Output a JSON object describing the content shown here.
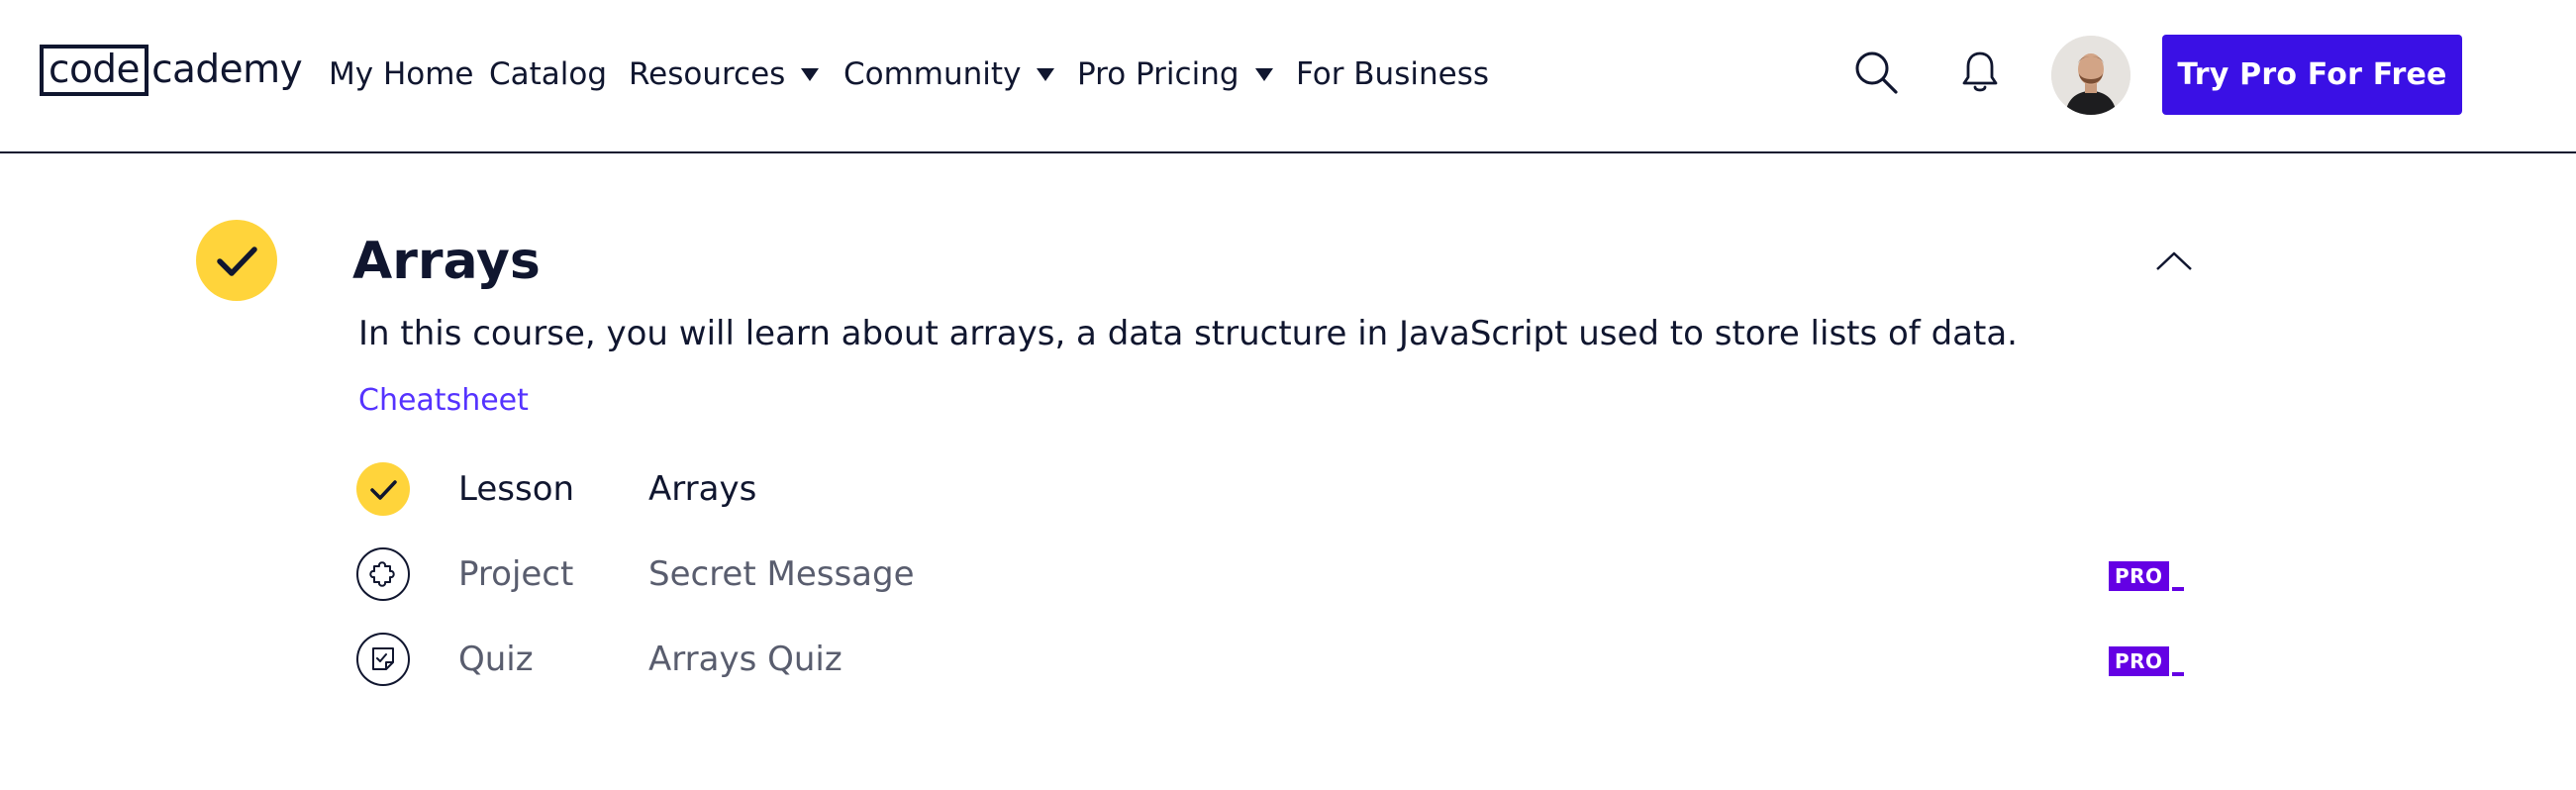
{
  "header": {
    "logo": {
      "boxed": "code",
      "rest": "cademy"
    },
    "nav": [
      {
        "label": "My Home",
        "dropdown": false
      },
      {
        "label": "Catalog",
        "dropdown": false
      },
      {
        "label": "Resources",
        "dropdown": true
      },
      {
        "label": "Community",
        "dropdown": true
      },
      {
        "label": "Pro Pricing",
        "dropdown": true
      },
      {
        "label": "For Business",
        "dropdown": false
      }
    ],
    "icons": [
      "search-icon",
      "bell-icon"
    ],
    "cta_label": "Try Pro For Free"
  },
  "module": {
    "title": "Arrays",
    "completed": true,
    "description": "In this course, you will learn about arrays, a data structure in JavaScript used to store lists of data.",
    "cheatsheet_label": "Cheatsheet",
    "items": [
      {
        "type": "Lesson",
        "name": "Arrays",
        "status": "completed",
        "icon": "check-icon",
        "pro": ""
      },
      {
        "type": "Project",
        "name": "Secret Message",
        "status": "locked",
        "icon": "puzzle-icon",
        "pro": "PRO"
      },
      {
        "type": "Quiz",
        "name": "Arrays Quiz",
        "status": "locked",
        "icon": "quiz-icon",
        "pro": "PRO"
      }
    ]
  },
  "colors": {
    "brand_navy": "#10162f",
    "cta_blue": "#3a10e5",
    "check_yellow": "#ffd43b",
    "link_purple": "#5533ff",
    "pro_purple": "#6400e4",
    "muted_text": "#595d6e"
  }
}
